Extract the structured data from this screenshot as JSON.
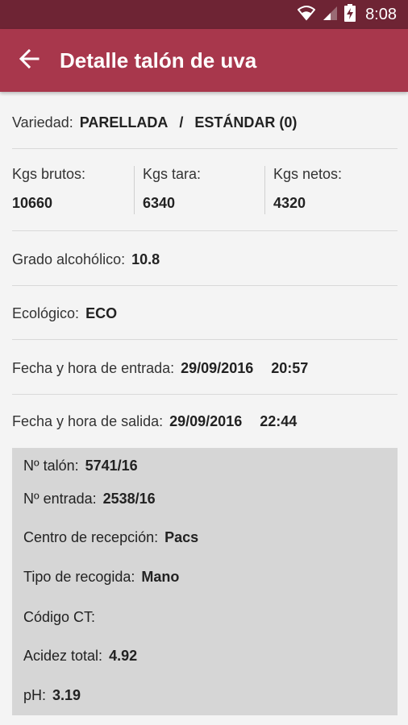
{
  "status_bar": {
    "time": "8:08",
    "icons": [
      "wifi-icon",
      "signal-icon",
      "battery-charging-icon"
    ]
  },
  "app_bar": {
    "title": "Detalle talón de uva",
    "back_icon": "arrow-back-icon"
  },
  "variety": {
    "label": "Variedad:",
    "value": "PARELLADA",
    "separator": "/",
    "type": "ESTÁNDAR (0)"
  },
  "weights": {
    "gross_label": "Kgs brutos:",
    "gross_value": "10660",
    "tare_label": "Kgs tara:",
    "tare_value": "6340",
    "net_label": "Kgs netos:",
    "net_value": "4320"
  },
  "alcohol": {
    "label": "Grado alcohólico:",
    "value": "10.8"
  },
  "ecological": {
    "label": "Ecológico:",
    "value": "ECO"
  },
  "entry": {
    "label": "Fecha y hora de entrada:",
    "date": "29/09/2016",
    "time": "20:57"
  },
  "exit": {
    "label": "Fecha y hora de salida:",
    "date": "29/09/2016",
    "time": "22:44"
  },
  "details": {
    "ticket_label": "Nº talón:",
    "ticket_value": "5741/16",
    "entry_no_label": "Nº entrada:",
    "entry_no_value": "2538/16",
    "center_label": "Centro de recepción:",
    "center_value": "Pacs",
    "harvest_label": "Tipo de recogida:",
    "harvest_value": "Mano",
    "ct_label": "Código CT:",
    "ct_value": "",
    "acidity_label": "Acidez total:",
    "acidity_value": "4.92",
    "ph_label": "pH:",
    "ph_value": "3.19"
  },
  "colors": {
    "status_bar": "#6e2434",
    "app_bar": "#a8374c",
    "background": "#f4f4f4",
    "details_box": "#d6d6d6"
  }
}
